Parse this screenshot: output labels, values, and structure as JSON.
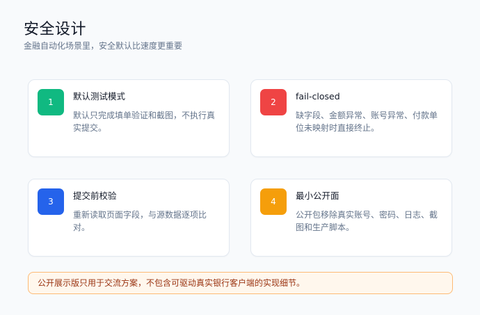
{
  "header": {
    "title": "安全设计",
    "subtitle": "金融自动化场景里，安全默认比速度更重要"
  },
  "cards": [
    {
      "number": "1",
      "title": "默认测试模式",
      "description": "默认只完成填单验证和截图，不执行真实提交。",
      "color": "#10b981"
    },
    {
      "number": "2",
      "title": "fail-closed",
      "description": "缺字段、金额异常、账号异常、付款单位未映射时直接终止。",
      "color": "#ef4444"
    },
    {
      "number": "3",
      "title": "提交前校验",
      "description": "重新读取页面字段，与源数据逐项比对。",
      "color": "#2563eb"
    },
    {
      "number": "4",
      "title": "最小公开面",
      "description": "公开包移除真实账号、密码、日志、截图和生产脚本。",
      "color": "#f59e0b"
    }
  ],
  "notice": {
    "text": "公开展示版只用于交流方案，不包含可驱动真实银行客户端的实现细节。"
  }
}
